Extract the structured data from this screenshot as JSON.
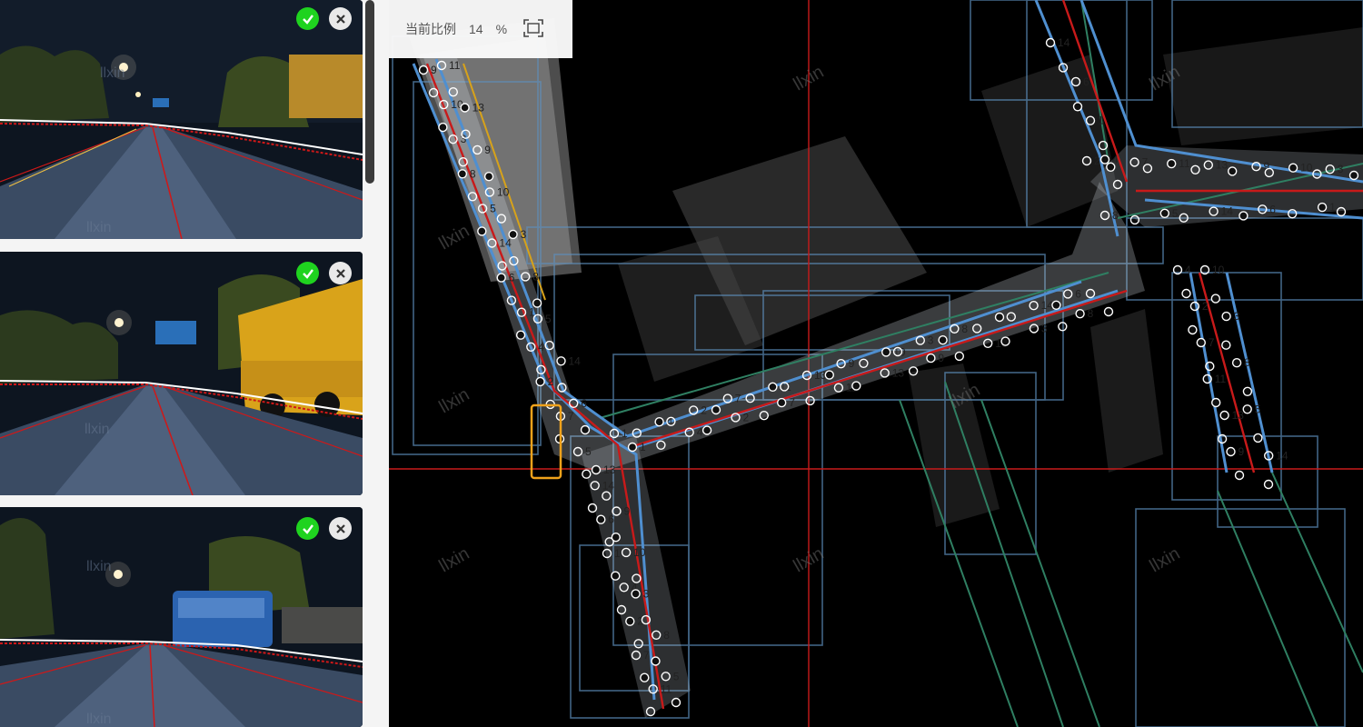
{
  "zoom": {
    "label": "当前比例",
    "value": "14",
    "unit": "%"
  },
  "watermark": "llxin",
  "colors": {
    "confirm": "#1fd31f",
    "dismiss": "#e9e9e9",
    "lane_red": "#c81a1a",
    "lane_blue": "#4f8fd0",
    "lane_green": "#2f7f62",
    "box_blue": "#5d8fbd",
    "selection": "#f0a21b"
  },
  "cards": [
    {
      "confirm_icon": "check-circle-icon",
      "dismiss_icon": "close-circle-icon"
    },
    {
      "confirm_icon": "check-circle-icon",
      "dismiss_icon": "close-circle-icon"
    },
    {
      "confirm_icon": "check-circle-icon",
      "dismiss_icon": "close-circle-icon"
    }
  ],
  "fit_icon": "fit-screen-icon",
  "point_labels": [
    "9",
    "1",
    "10",
    "4",
    "3",
    "2",
    "8",
    "7",
    "5",
    "11",
    "14",
    "13",
    "6"
  ]
}
